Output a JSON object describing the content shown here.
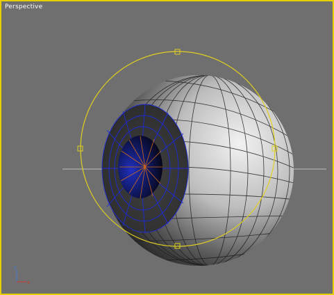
{
  "viewport": {
    "label": "Perspective",
    "active_border_color": "#e8d000",
    "background_color": "#6f6f6f"
  },
  "scene": {
    "objects": [
      {
        "name": "eyeball-sphere",
        "type": "sphere-mesh",
        "shading": "gray-smooth-with-wireframe"
      },
      {
        "name": "iris-region",
        "wire_color": "#1e2ad8"
      },
      {
        "name": "pupil",
        "color": "#0a0a33"
      }
    ],
    "selection_gizmo": {
      "type": "circle",
      "color": "#e0d020",
      "handles": 4
    },
    "horizon_line": true
  },
  "axis_tripod": {
    "labels": [
      "z",
      "x"
    ],
    "colors": {
      "z": "#4a7bd8",
      "x": "#cc3a2a"
    }
  }
}
